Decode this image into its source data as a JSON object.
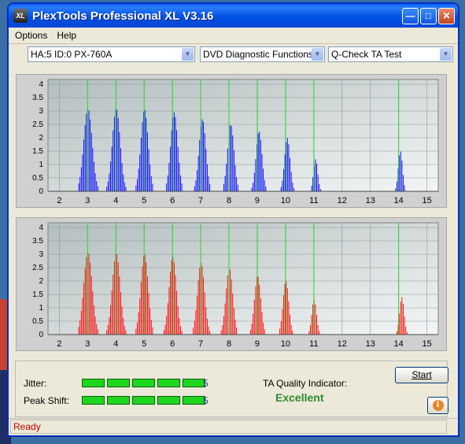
{
  "window": {
    "title": "PlexTools Professional XL V3.16",
    "icon_label": "XL"
  },
  "menu": [
    "Options",
    "Help"
  ],
  "combos": {
    "drive": "HA:5 ID:0  PX-760A",
    "function": "DVD Diagnostic Functions",
    "test": "Q-Check TA Test"
  },
  "chart_data": [
    {
      "type": "bar",
      "series": [
        {
          "name": "",
          "color": "#0000ff"
        }
      ],
      "x": [
        2,
        3,
        4,
        5,
        6,
        7,
        8,
        9,
        10,
        11,
        12,
        13,
        14,
        15
      ],
      "xlim": [
        1.6,
        15.4
      ],
      "ylim": [
        0,
        4
      ],
      "yticks": [
        "0",
        "0.5",
        "1",
        "1.5",
        "2",
        "2.5",
        "3",
        "3.5",
        "4"
      ],
      "xticks": [
        "2",
        "3",
        "4",
        "5",
        "6",
        "7",
        "8",
        "9",
        "10",
        "11",
        "12",
        "13",
        "14",
        "15"
      ],
      "marker_lines": [
        3,
        4,
        5,
        6,
        7,
        8,
        9,
        10,
        11,
        14
      ],
      "peaks": [
        {
          "center": 3.0,
          "height": 3.1,
          "width": 0.32
        },
        {
          "center": 4.0,
          "height": 3.1,
          "width": 0.3
        },
        {
          "center": 5.0,
          "height": 3.05,
          "width": 0.28
        },
        {
          "center": 6.05,
          "height": 2.95,
          "width": 0.27
        },
        {
          "center": 7.05,
          "height": 2.7,
          "width": 0.26
        },
        {
          "center": 8.05,
          "height": 2.5,
          "width": 0.25
        },
        {
          "center": 9.05,
          "height": 2.25,
          "width": 0.23
        },
        {
          "center": 10.05,
          "height": 2.0,
          "width": 0.21
        },
        {
          "center": 11.05,
          "height": 1.2,
          "width": 0.16
        },
        {
          "center": 14.05,
          "height": 1.5,
          "width": 0.16
        }
      ]
    },
    {
      "type": "bar",
      "series": [
        {
          "name": "",
          "color": "#ff0000"
        }
      ],
      "x": [
        2,
        3,
        4,
        5,
        6,
        7,
        8,
        9,
        10,
        11,
        12,
        13,
        14,
        15
      ],
      "xlim": [
        1.6,
        15.4
      ],
      "ylim": [
        0,
        4
      ],
      "yticks": [
        "0",
        "0.5",
        "1",
        "1.5",
        "2",
        "2.5",
        "3",
        "3.5",
        "4"
      ],
      "xticks": [
        "2",
        "3",
        "4",
        "5",
        "6",
        "7",
        "8",
        "9",
        "10",
        "11",
        "12",
        "13",
        "14",
        "15"
      ],
      "marker_lines": [
        3,
        4,
        5,
        6,
        7,
        8,
        9,
        10,
        11,
        14
      ],
      "peaks": [
        {
          "center": 3.0,
          "height": 3.1,
          "width": 0.32
        },
        {
          "center": 4.0,
          "height": 3.05,
          "width": 0.3
        },
        {
          "center": 5.0,
          "height": 3.0,
          "width": 0.28
        },
        {
          "center": 6.0,
          "height": 2.9,
          "width": 0.28
        },
        {
          "center": 7.0,
          "height": 2.7,
          "width": 0.27
        },
        {
          "center": 8.0,
          "height": 2.5,
          "width": 0.26
        },
        {
          "center": 9.0,
          "height": 2.2,
          "width": 0.24
        },
        {
          "center": 10.0,
          "height": 2.0,
          "width": 0.22
        },
        {
          "center": 11.0,
          "height": 1.3,
          "width": 0.18
        },
        {
          "center": 14.1,
          "height": 1.4,
          "width": 0.17
        }
      ]
    }
  ],
  "results": {
    "jitter_label": "Jitter:",
    "jitter_value": "5",
    "jitter_level": 5,
    "peak_label": "Peak Shift:",
    "peak_value": "5",
    "peak_level": 5,
    "ta_label": "TA Quality Indicator:",
    "ta_value": "Excellent",
    "start_label": "Start"
  },
  "status": "Ready",
  "icons": {
    "minimize": "minimize-icon",
    "maximize": "maximize-icon",
    "close": "close-icon",
    "info": "info-icon",
    "dropdown": "chevron-down-icon"
  }
}
